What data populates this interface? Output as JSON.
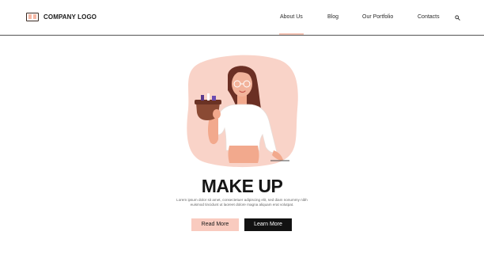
{
  "header": {
    "logo_text": "COMPANY LOGO",
    "nav": [
      {
        "label": "About Us",
        "active": true
      },
      {
        "label": "Blog",
        "active": false
      },
      {
        "label": "Our Portfolio",
        "active": false
      },
      {
        "label": "Contacts",
        "active": false
      }
    ],
    "search_icon": "search-icon"
  },
  "hero": {
    "title": "MAKE UP",
    "body_line1": "Lorem ipsum dolor sit amet, consectetuer adipiscing elit, sed diam nonummy nibh",
    "body_line2": "euismod tincidunt ut laoreet dolore magna aliquam erat volutpat.",
    "read_more_label": "Read More",
    "learn_more_label": "Learn More"
  },
  "colors": {
    "accent_peach": "#f9cbbf",
    "dark": "#121212"
  }
}
